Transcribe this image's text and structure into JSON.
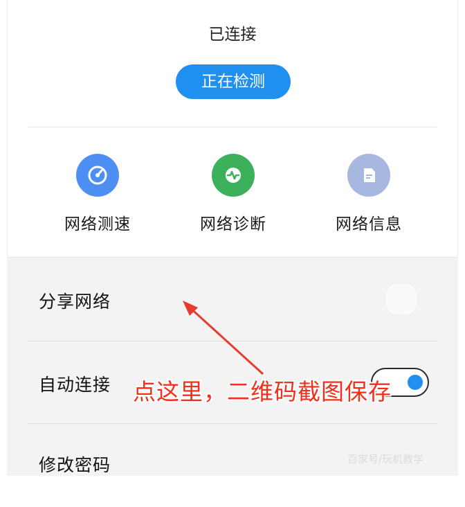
{
  "status": {
    "text": "已连接"
  },
  "detect_button": {
    "label": "正在检测"
  },
  "tools": [
    {
      "label": "网络测速",
      "icon": "speedometer-icon",
      "color": "#4d8ff2"
    },
    {
      "label": "网络诊断",
      "icon": "pulse-icon",
      "color": "#3cb05a"
    },
    {
      "label": "网络信息",
      "icon": "document-icon",
      "color": "#a8b7df"
    }
  ],
  "settings": [
    {
      "label": "分享网络"
    },
    {
      "label": "自动连接",
      "toggle_on": true
    },
    {
      "label": "修改密码"
    }
  ],
  "annotation": {
    "text": "点这里，二维码截图保存",
    "color": "#f0301d"
  },
  "watermark": {
    "text": "百家号/玩机教学"
  }
}
